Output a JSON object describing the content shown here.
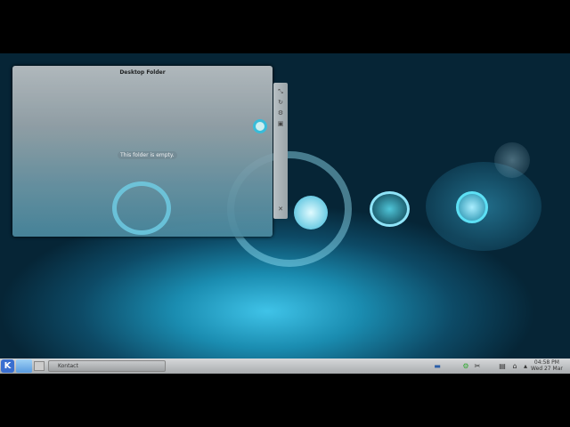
{
  "folder_widget": {
    "title": "Desktop Folder",
    "empty_message": "This folder is empty."
  },
  "widget_toolbar": {
    "resize": "⤡",
    "rotate": "↻",
    "settings": "⚙",
    "config": "▣",
    "close": "✕"
  },
  "taskbar": {
    "kmenu": "K",
    "task": "Kontact",
    "clock_time": "04:58 PM",
    "clock_date": "Wed 27 Mar"
  },
  "tray": [
    "▬",
    "⚙",
    "✂",
    "▤",
    "⌂",
    "▴"
  ]
}
